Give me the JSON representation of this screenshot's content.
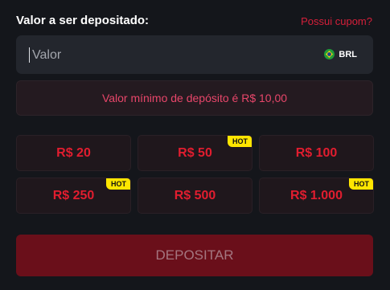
{
  "header": {
    "title": "Valor a ser depositado:",
    "coupon_link": "Possui cupom?"
  },
  "amount_input": {
    "value": "",
    "placeholder": "Valor",
    "currency": "BRL",
    "currency_icon": "brazil-flag-icon"
  },
  "min_deposit_message": "Valor mínimo de depósito é R$ 10,00",
  "quick_amounts": [
    {
      "label": "R$ 20",
      "badge": ""
    },
    {
      "label": "R$ 50",
      "badge": "HOT"
    },
    {
      "label": "R$ 100",
      "badge": ""
    },
    {
      "label": "R$ 250",
      "badge": "HOT"
    },
    {
      "label": "R$ 500",
      "badge": ""
    },
    {
      "label": "R$ 1.000",
      "badge": "HOT"
    }
  ],
  "deposit_button": "DEPOSITAR",
  "colors": {
    "background": "#14161b",
    "accent_red": "#e11d2f",
    "hot_badge": "#ffe600",
    "deposit_button_bg": "#6a0f1a"
  }
}
